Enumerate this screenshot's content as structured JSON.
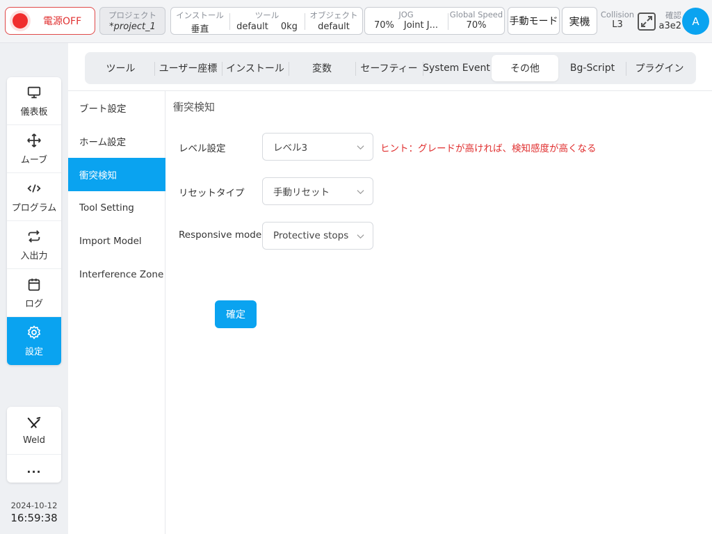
{
  "topbar": {
    "power_label": "電源OFF",
    "project": {
      "caption": "プロジェクト",
      "value": "*project_1"
    },
    "install": {
      "caption": "インストール",
      "value": "垂直"
    },
    "tool": {
      "caption": "ツール",
      "value": "default",
      "weight": "0kg"
    },
    "object": {
      "caption": "オブジェクト",
      "value": "default"
    },
    "jog": {
      "caption": "JOG",
      "value": "70%",
      "mode": "Joint J..."
    },
    "global_speed": {
      "caption": "Global Speed",
      "value": "70%"
    },
    "manual_mode": "手動モード",
    "real_machine": "実機",
    "collision": {
      "caption": "Collision",
      "value": "L3"
    },
    "confirm": {
      "caption": "確認",
      "value": "a3e2"
    },
    "avatar_letter": "A"
  },
  "sidebar": {
    "items": [
      {
        "label": "儀表板",
        "icon": "monitor-icon"
      },
      {
        "label": "ムーブ",
        "icon": "move-icon"
      },
      {
        "label": "プログラム",
        "icon": "code-icon"
      },
      {
        "label": "入出力",
        "icon": "io-icon"
      },
      {
        "label": "ログ",
        "icon": "calendar-icon"
      },
      {
        "label": "設定",
        "icon": "gear-icon"
      }
    ],
    "plugins": [
      {
        "label": "Weld",
        "icon": "weld-icon"
      },
      {
        "label": "...",
        "icon": "more-icon"
      }
    ],
    "date": "2024-10-12",
    "time": "16:59:38"
  },
  "tabs": [
    "ツール",
    "ユーザー座標",
    "インストール",
    "変数",
    "セーフティー",
    "System Event",
    "その他",
    "Bg-Script",
    "プラグイン"
  ],
  "subnav": [
    "ブート設定",
    "ホーム設定",
    "衝突検知",
    "Tool Setting",
    "Import Model",
    "Interference Zone"
  ],
  "content": {
    "title": "衝突検知",
    "level": {
      "label": "レベル設定",
      "value": "レベル3"
    },
    "hint": "ヒント：グレードが高ければ、検知感度が高くなる",
    "reset": {
      "label": "リセットタイプ",
      "value": "手動リセット"
    },
    "responsive": {
      "label": "Responsive mode",
      "value": "Protective stops"
    },
    "ok_label": "確定"
  },
  "colors": {
    "accent": "#0aa3f0",
    "danger": "#e02f2f"
  }
}
